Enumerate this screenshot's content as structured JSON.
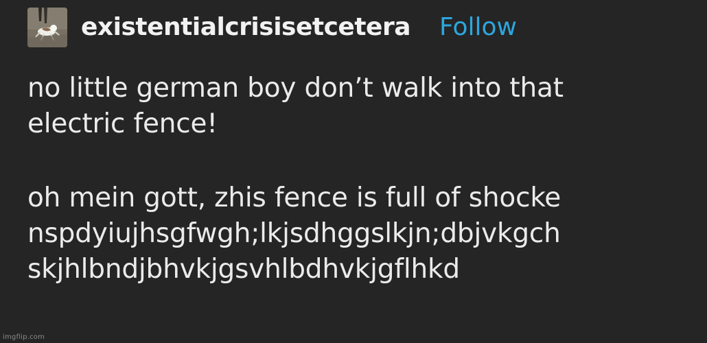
{
  "post": {
    "username": "existentialcrisisetcetera",
    "follow_label": "Follow",
    "paragraph1": [
      "no little german boy don’t walk into that",
      "electric fence!"
    ],
    "paragraph2": [
      "oh mein gott, zhis fence is full of shocke",
      "nspdyiujhsgfwgh;lkjsdhggslkjn;dbjvkgch",
      "skjhlbndjbhvkjgsvhlbdhvkjgflhkd"
    ]
  },
  "watermark": "imgflip.com",
  "colors": {
    "background": "#252525",
    "text": "#ebebeb",
    "follow": "#2ca7df"
  }
}
